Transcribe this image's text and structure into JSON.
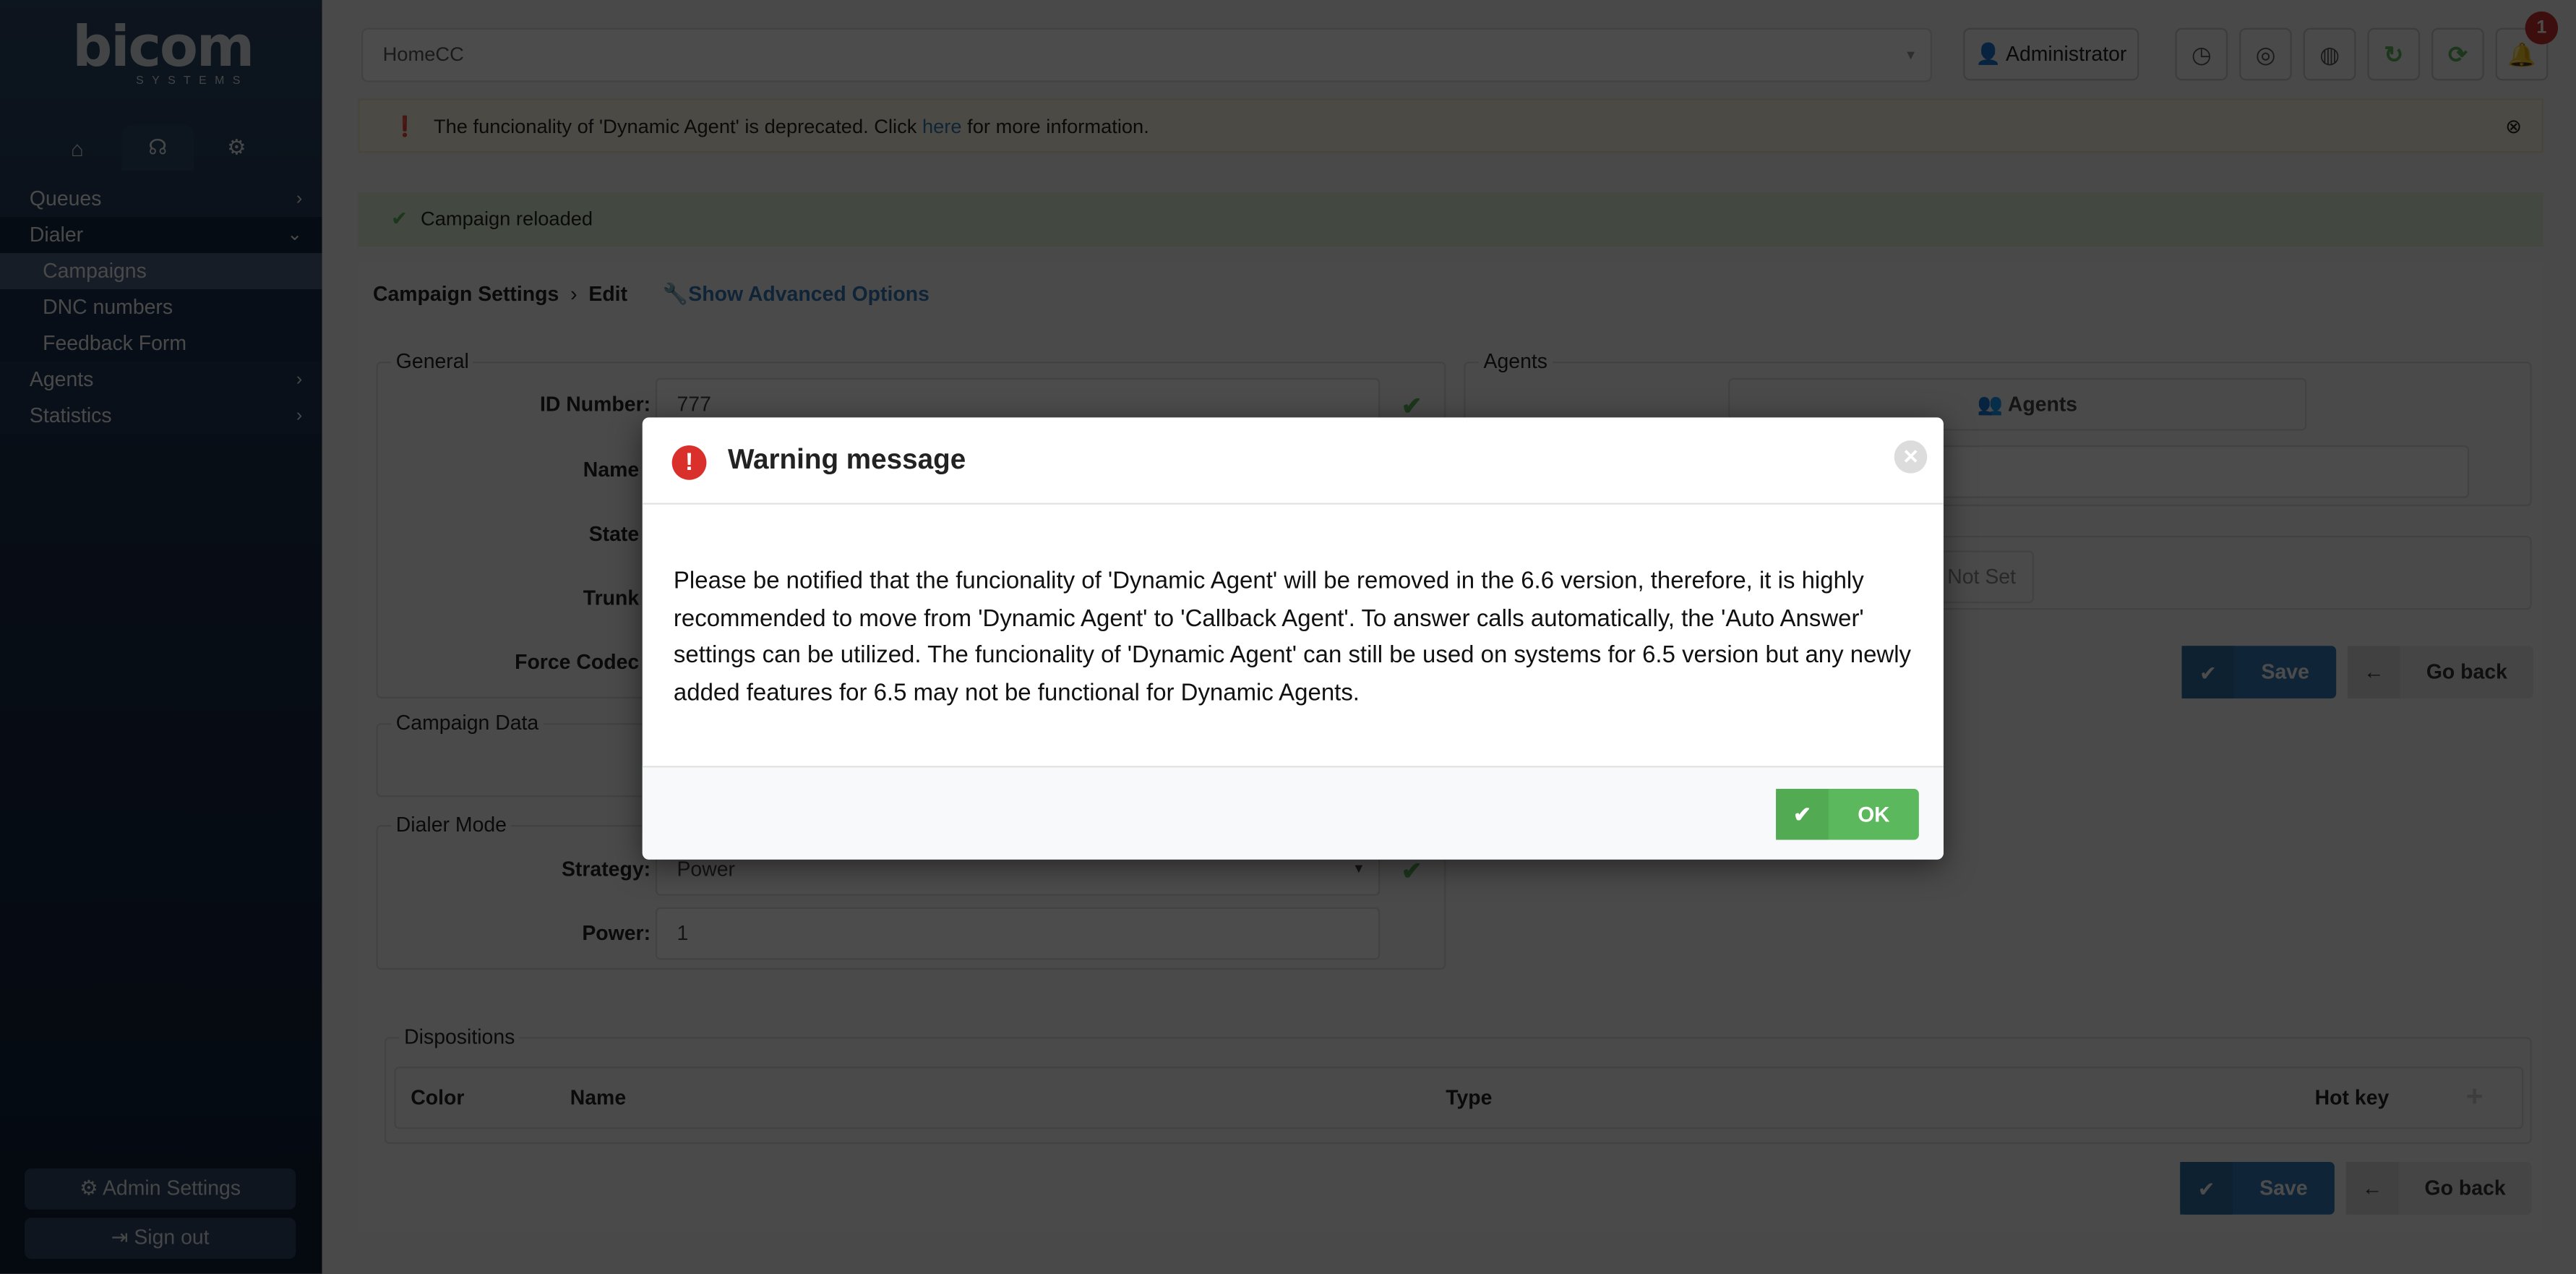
{
  "sidebar": {
    "logo": "bicom",
    "logo_sub": "SYSTEMS",
    "tabs": [
      {
        "icon": "home-icon"
      },
      {
        "icon": "headset-icon"
      },
      {
        "icon": "gears-icon"
      }
    ],
    "items": [
      {
        "label": "Queues"
      },
      {
        "label": "Dialer"
      },
      {
        "label": "Campaigns"
      },
      {
        "label": "DNC numbers"
      },
      {
        "label": "Feedback Form"
      },
      {
        "label": "Agents"
      },
      {
        "label": "Statistics"
      }
    ],
    "admin_settings": "Admin Settings",
    "sign_out": "Sign out"
  },
  "header": {
    "tenant_select": "HomeCC",
    "user": "Administrator",
    "notification_count": "1",
    "icons": [
      "clock-icon",
      "lifebuoy-icon",
      "globe-icon",
      "reload-icon",
      "sync-icon",
      "bell-icon"
    ]
  },
  "alerts": {
    "deprecation_before": "The funcionality of 'Dynamic Agent' is deprecated. Click ",
    "deprecation_link": "here",
    "deprecation_after": " for more information.",
    "success": "Campaign reloaded"
  },
  "breadcrumb": {
    "root": "Campaign Settings",
    "current": "Edit",
    "advanced": "Show Advanced Options"
  },
  "form": {
    "general_legend": "General",
    "id_label": "ID Number:",
    "id_value": "777",
    "name_label": "Name",
    "state_label": "State",
    "trunk_label": "Trunk",
    "codec_label": "Force Codec",
    "agents_legend": "Agents",
    "agents_button": "Agents",
    "not_set": "Not Set",
    "campaign_data_legend": "Campaign Data",
    "dialer_mode_legend": "Dialer Mode",
    "strategy_label": "Strategy:",
    "strategy_value": "Power",
    "power_label": "Power:",
    "power_value": "1",
    "save": "Save",
    "go_back": "Go back",
    "dispositions_legend": "Dispositions",
    "disp_columns": [
      "Color",
      "Name",
      "Type",
      "Hot key"
    ]
  },
  "modal": {
    "title": "Warning message",
    "body": "Please be notified that the funcionality of 'Dynamic Agent' will be removed in the 6.6 version, therefore, it is highly recommended to move from 'Dynamic Agent' to 'Callback Agent'. To answer calls automatically, the 'Auto Answer' settings can be utilized. The funcionality of 'Dynamic Agent' can still be used on systems for 6.5 version but any newly added features for 6.5 may not be functional for Dynamic Agents.",
    "ok": "OK"
  },
  "colors": {
    "primary": "#337ab7",
    "success": "#5cb85c",
    "danger": "#d9302c",
    "sidebar": "#1a2d47"
  }
}
